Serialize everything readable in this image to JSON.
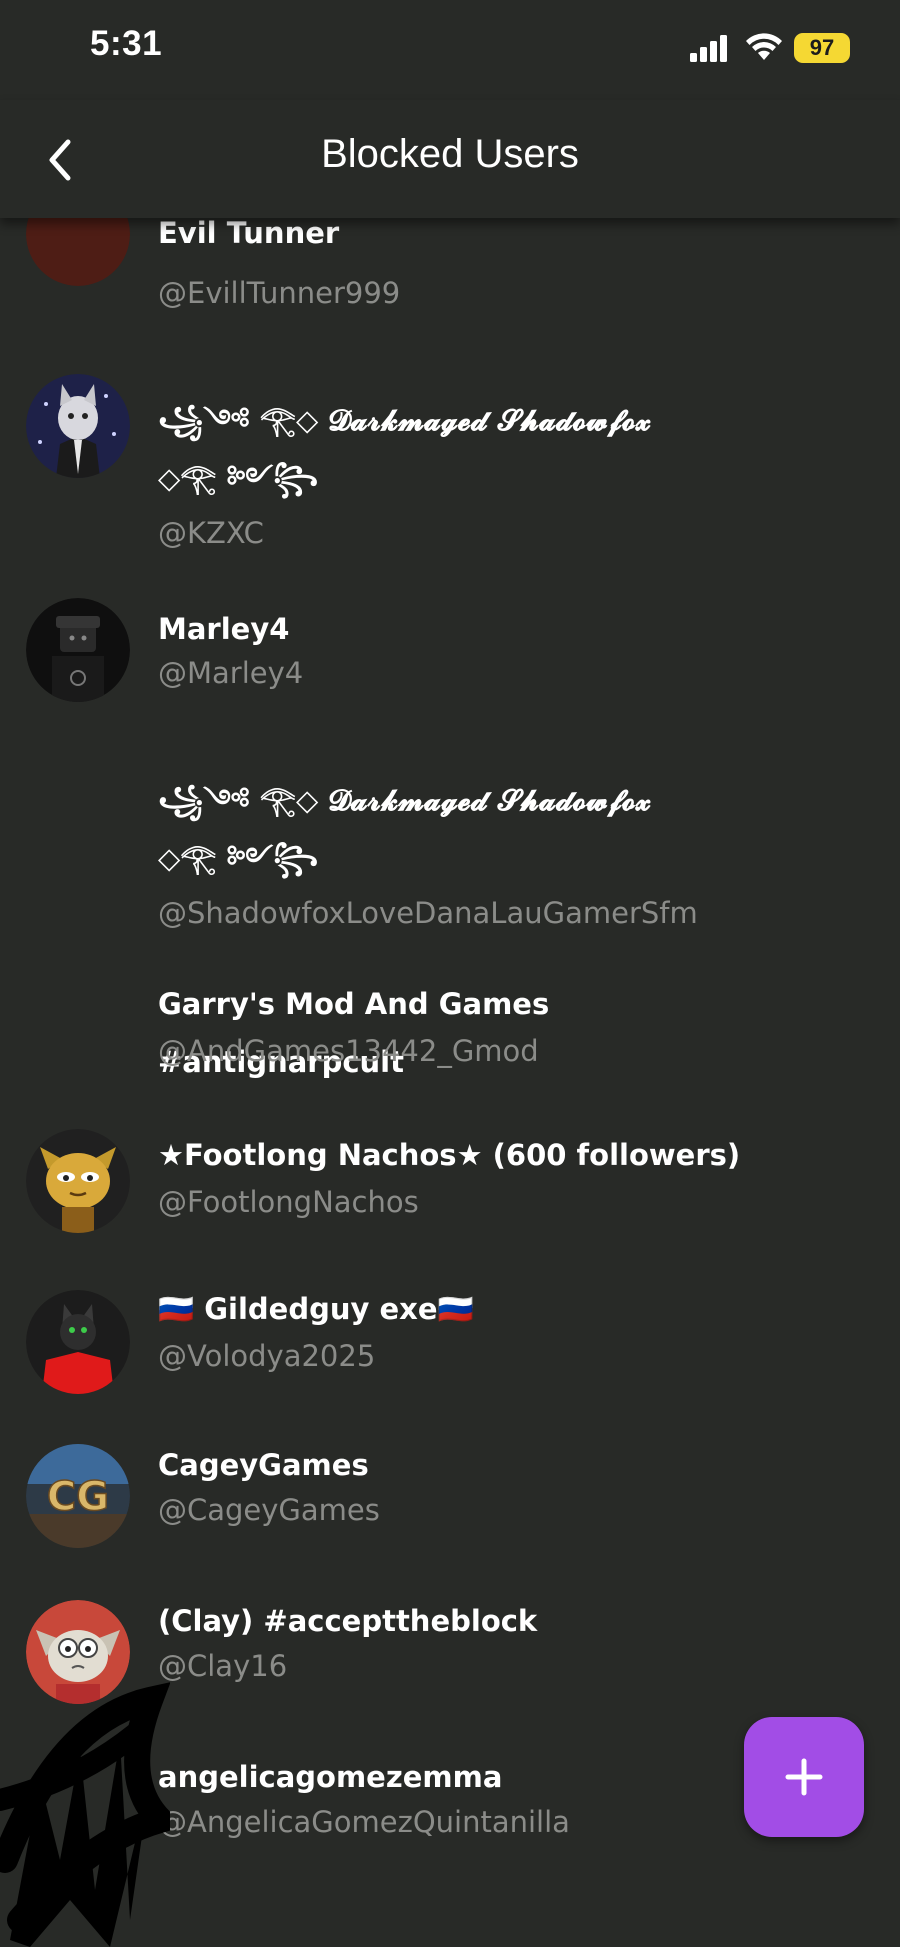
{
  "status_bar": {
    "time": "5:31",
    "battery": "97",
    "battery_color": "#f5d833"
  },
  "header": {
    "title": "Blocked Users",
    "back_icon": "chevron-left-icon"
  },
  "users": [
    {
      "name": "Evil Tunner",
      "handle": "@EvillTunner999",
      "avatar": "dark-red-avatar"
    },
    {
      "name": "꧁༺ 𓂀◇ 𝓓𝓪𝓻𝓴𝓶𝓪𝓰𝓮𝓭 𝓢𝓱𝓪𝓭𝓸𝔀𝓯𝓸𝔁\n◇𓂀 ༻꧂",
      "handle": "@KZXC",
      "avatar": "wolf-avatar"
    },
    {
      "name": "Marley4",
      "handle": "@Marley4",
      "avatar": "roblox-avatar"
    },
    {
      "name": "꧁༺ 𓂀◇ 𝓓𝓪𝓻𝓴𝓶𝓪𝓰𝓮𝓭 𝓢𝓱𝓪𝓭𝓸𝔀𝓯𝓸𝔁\n◇𓂀 ༻꧂",
      "handle": "@ShadowfoxLoveDanaLauGamerSfm",
      "avatar": ""
    },
    {
      "name": "Garry's Mod And Games #antignarpcult",
      "handle": "@AndGames13442_Gmod",
      "avatar": ""
    },
    {
      "name": "★Footlong Nachos★ (600 followers)",
      "handle": "@FootlongNachos",
      "avatar": "cartoon-cat-avatar"
    },
    {
      "name": "🇷🇺 Gildedguy exe🇷🇺",
      "handle": "@Volodya2025",
      "avatar": "red-shirt-avatar"
    },
    {
      "name": "CageyGames",
      "handle": "@CageyGames",
      "avatar": "cg-logo-avatar"
    },
    {
      "name": "(Clay) #accepttheblock",
      "handle": "@Clay16",
      "avatar": "clay-cartoon-avatar"
    },
    {
      "name": "angelicagomezemma",
      "handle": "@AngelicaGomezQuintanilla",
      "avatar": "scribbled-avatar"
    }
  ],
  "fab": {
    "icon": "plus-icon",
    "color": "#a24de6"
  }
}
